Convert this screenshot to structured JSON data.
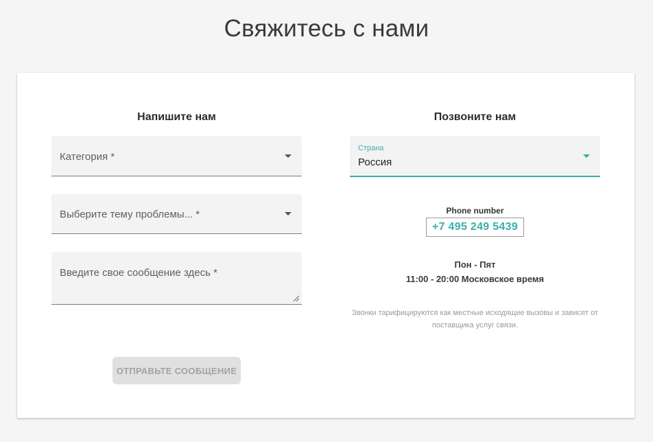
{
  "page": {
    "title": "Свяжитесь с нами"
  },
  "write_us": {
    "heading": "Напишите нам",
    "category_placeholder": "Категория *",
    "topic_placeholder": "Выберите тему проблемы... *",
    "message_placeholder": "Введите свое сообщение здесь *",
    "submit_label": "ОТПРАВЬТЕ СООБЩЕНИЕ"
  },
  "call_us": {
    "heading": "Позвоните нам",
    "country_label": "Страна",
    "country_value": "Россия",
    "phone_label": "Phone number",
    "phone_value": "+7 495 249 5439",
    "days": "Пон - Пят",
    "hours": "11:00 - 20:00 Московское время",
    "note_line1": "Звонки тарифицируются как местные исходящие вызовы и зависят от",
    "note_line2": "поставщика услуг связи."
  },
  "colors": {
    "accent": "#3aaea9",
    "background": "#f5f5f5",
    "card": "#ffffff",
    "disabled_button": "#e0e0e0"
  }
}
